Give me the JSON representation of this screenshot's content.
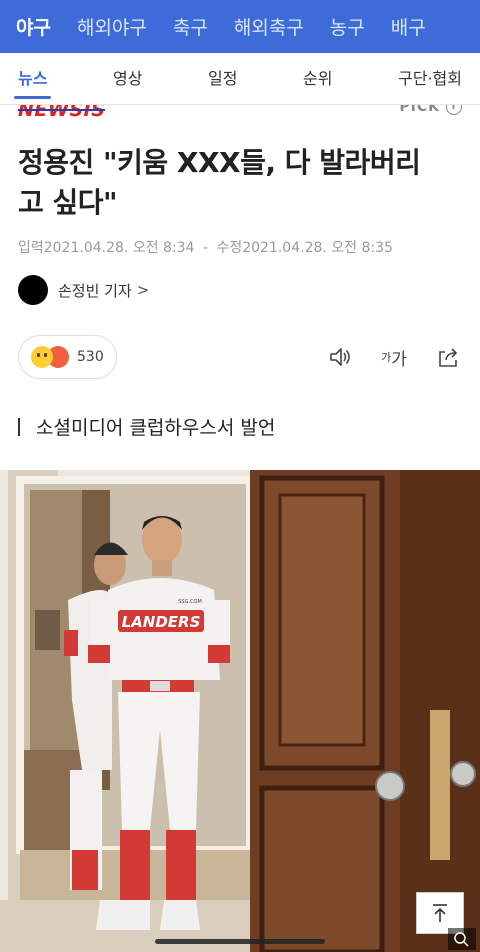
{
  "top_nav": [
    "야구",
    "해외야구",
    "축구",
    "해외축구",
    "농구",
    "배구"
  ],
  "sub_nav": [
    "뉴스",
    "영상",
    "일정",
    "순위",
    "구단·협회"
  ],
  "press": {
    "logo_text": "NEWSIS",
    "pick_label": "PICK",
    "info_glyph": "i"
  },
  "article": {
    "title_line1": "정용진 \"키움 XXX들, 다 발라버리",
    "title_line2": "고 싶다\"",
    "input_label": "입력",
    "input_date": "2021.04.28. 오전 8:34",
    "sep": "-",
    "modified_label": "수정",
    "modified_date": "2021.04.28. 오전 8:35",
    "reporter": "손정빈 기자",
    "reporter_chevron": ">",
    "reaction_count": "530",
    "font_size_small": "가",
    "font_size_large": "가",
    "subheading": "소셜미디어 클럽하우스서 발언"
  },
  "photo": {
    "jersey_text": "LANDERS",
    "jersey_small_text": "SSG.COM"
  },
  "colors": {
    "nav_bg": "#3D6BD8",
    "accent": "#3D6BD8",
    "logo_red": "#DD2222"
  },
  "icons": [
    "speaker-icon",
    "font-size-icon",
    "share-icon",
    "scroll-to-top-icon",
    "zoom-icon"
  ]
}
